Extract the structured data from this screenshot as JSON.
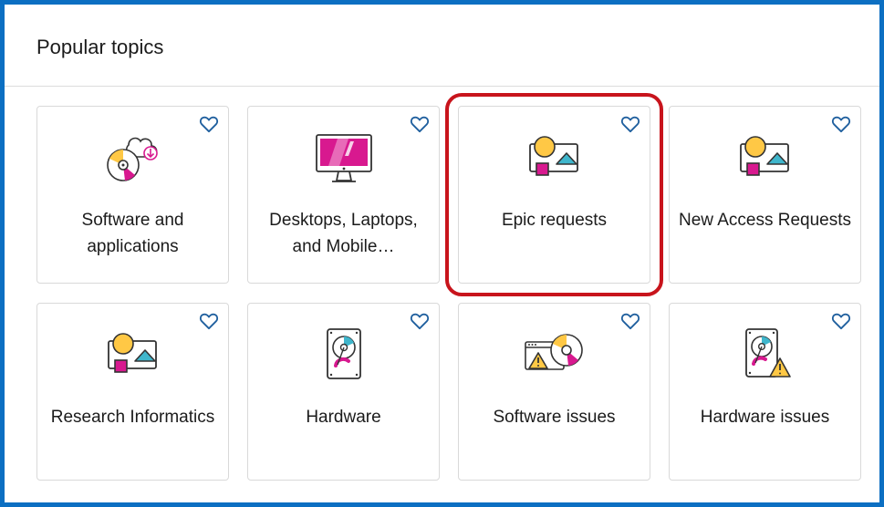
{
  "section": {
    "title": "Popular topics"
  },
  "colors": {
    "frame_border": "#0c6fc2",
    "highlight": "#c8141c",
    "heart": "#1f5f9e",
    "magenta": "#d8198f",
    "yellow": "#ffc845",
    "teal": "#3fb6cc"
  },
  "tiles": [
    {
      "label": "Software and applications",
      "icon": "software-cd-cloud-icon",
      "favorite_icon": "heart-icon"
    },
    {
      "label": "Desktops, Laptops, and Mobile…",
      "icon": "desktop-monitor-icon",
      "favorite_icon": "heart-icon"
    },
    {
      "label": "Epic requests",
      "icon": "shapes-image-icon",
      "favorite_icon": "heart-icon",
      "highlighted": true
    },
    {
      "label": "New Access Requests",
      "icon": "shapes-image-icon",
      "favorite_icon": "heart-icon"
    },
    {
      "label": "Research Informatics",
      "icon": "shapes-image-icon",
      "favorite_icon": "heart-icon"
    },
    {
      "label": "Hardware",
      "icon": "hard-drive-icon",
      "favorite_icon": "heart-icon"
    },
    {
      "label": "Software issues",
      "icon": "software-warning-icon",
      "favorite_icon": "heart-icon"
    },
    {
      "label": "Hardware issues",
      "icon": "hard-drive-warning-icon",
      "favorite_icon": "heart-icon"
    }
  ]
}
